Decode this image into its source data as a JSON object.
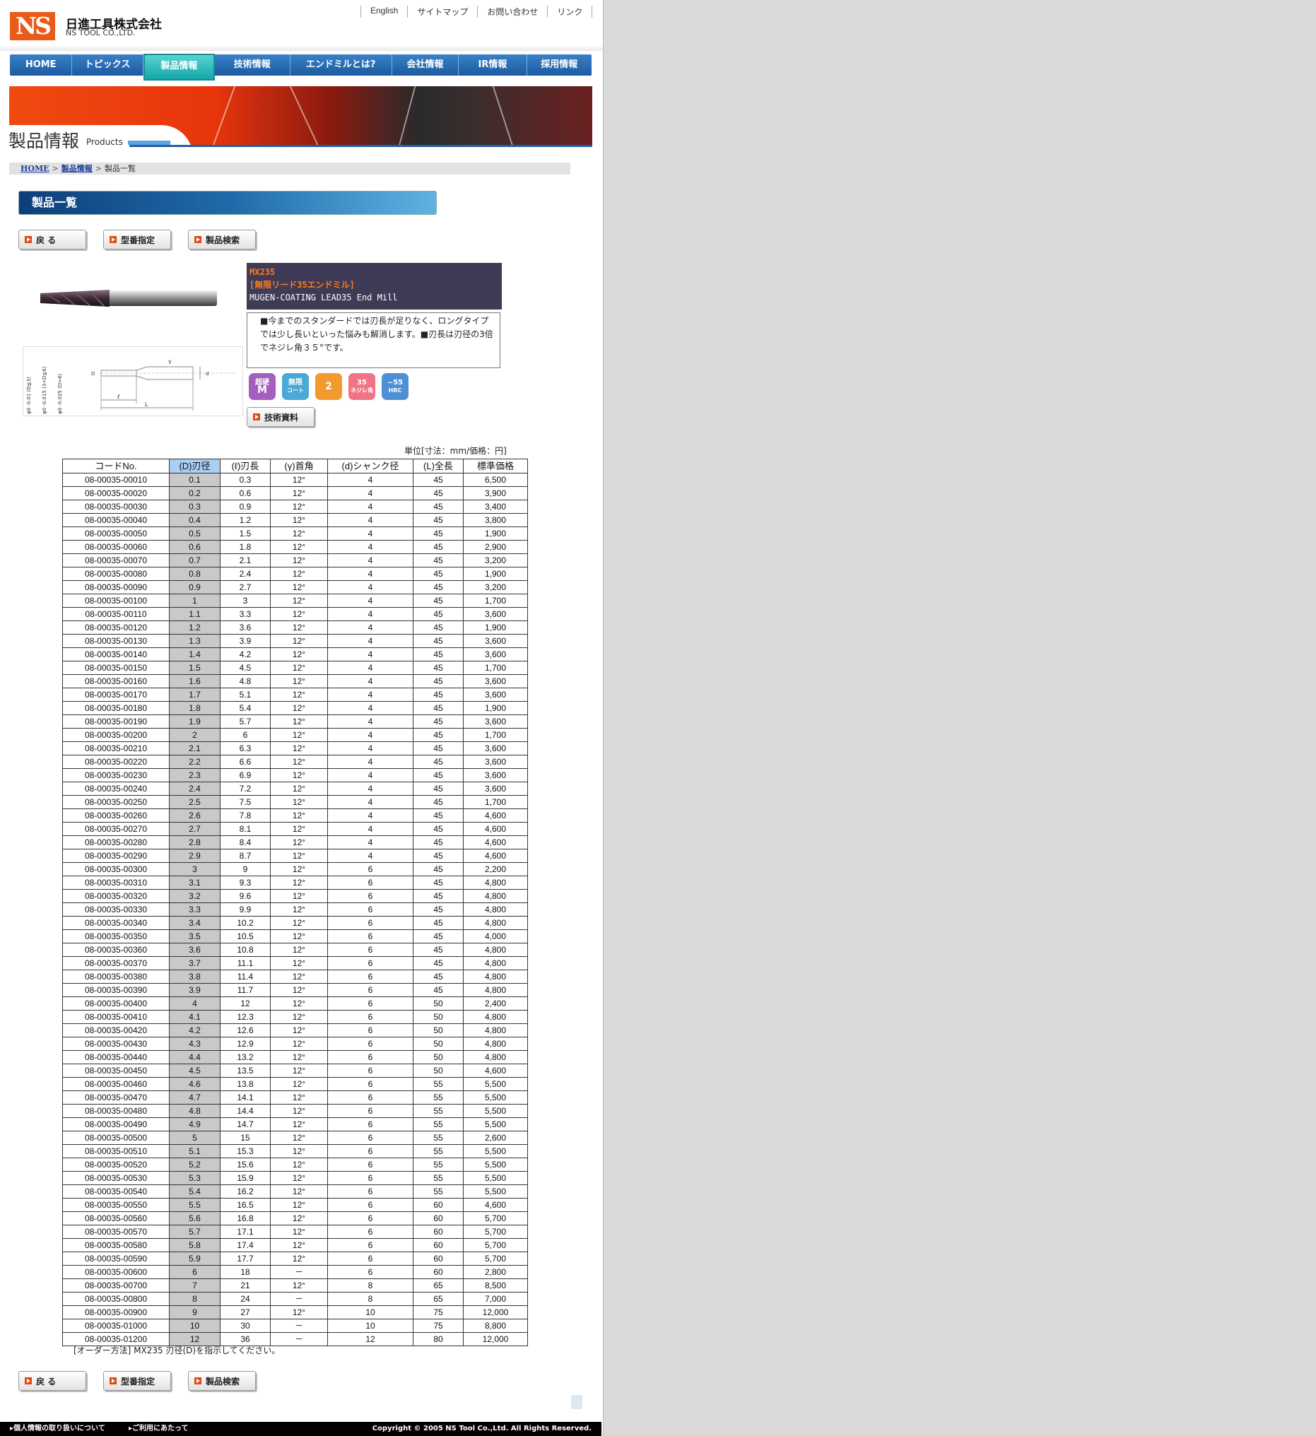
{
  "header": {
    "logo_text": "NS",
    "company_name": "日進工具株式会社",
    "company_name_en": "NS TOOL CO.,LTD.",
    "util_nav": [
      "English",
      "サイトマップ",
      "お問い合わせ",
      "リンク"
    ]
  },
  "main_nav": {
    "items": [
      "HOME",
      "トピックス",
      "製品情報",
      "技術情報",
      "エンドミルとは?",
      "会社情報",
      "IR情報",
      "採用情報"
    ],
    "active": "製品情報"
  },
  "banner": {
    "title": "製品情報",
    "subtitle": "Products"
  },
  "breadcrumb": {
    "home": "HOME",
    "products": "製品情報",
    "current": "製品一覧"
  },
  "section_title": "製品一覧",
  "buttons": {
    "back": "戻 る",
    "model_select": "型番指定",
    "product_search": "製品検索",
    "tech_docs": "技術資料"
  },
  "product": {
    "code": "MX235",
    "name_jp": "[無限リード35エンドミル]",
    "name_en": "MUGEN-COATING LEAD35 End Mill",
    "description": "■今までのスタンダードでは刃長が足りなく、ロングタイプでは少し長いといった悩みも解消します。■刃長は刃径の3倍でネジレ角３５°です。",
    "drawing_labels": {
      "shank_tol_small": "φ0 -0.01 (D≦3)",
      "shank_tol_mid": "φ0 -0.015 (3<D≦6)",
      "shank_tol_large": "φ0 -0.025 (D>6)",
      "gamma": "γ",
      "l": "ℓ",
      "L": "L",
      "d": "d",
      "D": "D"
    },
    "feature_icons": [
      {
        "name": "super-hard-m-icon",
        "line1": "超硬",
        "line2": "M",
        "color": "#a35fbe"
      },
      {
        "name": "mugen-coat-icon",
        "line1": "無限",
        "line2": "コート",
        "color": "#4aa9d8"
      },
      {
        "name": "two-flute-icon",
        "line1": "",
        "line2": "2",
        "color": "#f29a2e"
      },
      {
        "name": "helix-35-icon",
        "line1": "35",
        "line2": "ネジレ角",
        "color": "#f07484"
      },
      {
        "name": "hrc-55-icon",
        "line1": "~55",
        "line2": "HRC",
        "color": "#4f8fd6"
      }
    ]
  },
  "table": {
    "unit_note": "単位[寸法：mm/価格：円]",
    "headers": [
      "コードNo.",
      "(D)刃径",
      "(ℓ)刃長",
      "(γ)首角",
      "(d)シャンク径",
      "(L)全長",
      "標準価格"
    ],
    "highlight_header": "(D)刃径",
    "rows": [
      [
        "08-00035-00010",
        "0.1",
        "0.3",
        "12°",
        "4",
        "45",
        "6,500"
      ],
      [
        "08-00035-00020",
        "0.2",
        "0.6",
        "12°",
        "4",
        "45",
        "3,900"
      ],
      [
        "08-00035-00030",
        "0.3",
        "0.9",
        "12°",
        "4",
        "45",
        "3,400"
      ],
      [
        "08-00035-00040",
        "0.4",
        "1.2",
        "12°",
        "4",
        "45",
        "3,800"
      ],
      [
        "08-00035-00050",
        "0.5",
        "1.5",
        "12°",
        "4",
        "45",
        "1,900"
      ],
      [
        "08-00035-00060",
        "0.6",
        "1.8",
        "12°",
        "4",
        "45",
        "2,900"
      ],
      [
        "08-00035-00070",
        "0.7",
        "2.1",
        "12°",
        "4",
        "45",
        "3,200"
      ],
      [
        "08-00035-00080",
        "0.8",
        "2.4",
        "12°",
        "4",
        "45",
        "1,900"
      ],
      [
        "08-00035-00090",
        "0.9",
        "2.7",
        "12°",
        "4",
        "45",
        "3,200"
      ],
      [
        "08-00035-00100",
        "1",
        "3",
        "12°",
        "4",
        "45",
        "1,700"
      ],
      [
        "08-00035-00110",
        "1.1",
        "3.3",
        "12°",
        "4",
        "45",
        "3,600"
      ],
      [
        "08-00035-00120",
        "1.2",
        "3.6",
        "12°",
        "4",
        "45",
        "1,900"
      ],
      [
        "08-00035-00130",
        "1.3",
        "3.9",
        "12°",
        "4",
        "45",
        "3,600"
      ],
      [
        "08-00035-00140",
        "1.4",
        "4.2",
        "12°",
        "4",
        "45",
        "3,600"
      ],
      [
        "08-00035-00150",
        "1.5",
        "4.5",
        "12°",
        "4",
        "45",
        "1,700"
      ],
      [
        "08-00035-00160",
        "1.6",
        "4.8",
        "12°",
        "4",
        "45",
        "3,600"
      ],
      [
        "08-00035-00170",
        "1.7",
        "5.1",
        "12°",
        "4",
        "45",
        "3,600"
      ],
      [
        "08-00035-00180",
        "1.8",
        "5.4",
        "12°",
        "4",
        "45",
        "1,900"
      ],
      [
        "08-00035-00190",
        "1.9",
        "5.7",
        "12°",
        "4",
        "45",
        "3,600"
      ],
      [
        "08-00035-00200",
        "2",
        "6",
        "12°",
        "4",
        "45",
        "1,700"
      ],
      [
        "08-00035-00210",
        "2.1",
        "6.3",
        "12°",
        "4",
        "45",
        "3,600"
      ],
      [
        "08-00035-00220",
        "2.2",
        "6.6",
        "12°",
        "4",
        "45",
        "3,600"
      ],
      [
        "08-00035-00230",
        "2.3",
        "6.9",
        "12°",
        "4",
        "45",
        "3,600"
      ],
      [
        "08-00035-00240",
        "2.4",
        "7.2",
        "12°",
        "4",
        "45",
        "3,600"
      ],
      [
        "08-00035-00250",
        "2.5",
        "7.5",
        "12°",
        "4",
        "45",
        "1,700"
      ],
      [
        "08-00035-00260",
        "2.6",
        "7.8",
        "12°",
        "4",
        "45",
        "4,600"
      ],
      [
        "08-00035-00270",
        "2.7",
        "8.1",
        "12°",
        "4",
        "45",
        "4,600"
      ],
      [
        "08-00035-00280",
        "2.8",
        "8.4",
        "12°",
        "4",
        "45",
        "4,600"
      ],
      [
        "08-00035-00290",
        "2.9",
        "8.7",
        "12°",
        "4",
        "45",
        "4,600"
      ],
      [
        "08-00035-00300",
        "3",
        "9",
        "12°",
        "6",
        "45",
        "2,200"
      ],
      [
        "08-00035-00310",
        "3.1",
        "9.3",
        "12°",
        "6",
        "45",
        "4,800"
      ],
      [
        "08-00035-00320",
        "3.2",
        "9.6",
        "12°",
        "6",
        "45",
        "4,800"
      ],
      [
        "08-00035-00330",
        "3.3",
        "9.9",
        "12°",
        "6",
        "45",
        "4,800"
      ],
      [
        "08-00035-00340",
        "3.4",
        "10.2",
        "12°",
        "6",
        "45",
        "4,800"
      ],
      [
        "08-00035-00350",
        "3.5",
        "10.5",
        "12°",
        "6",
        "45",
        "4,000"
      ],
      [
        "08-00035-00360",
        "3.6",
        "10.8",
        "12°",
        "6",
        "45",
        "4,800"
      ],
      [
        "08-00035-00370",
        "3.7",
        "11.1",
        "12°",
        "6",
        "45",
        "4,800"
      ],
      [
        "08-00035-00380",
        "3.8",
        "11.4",
        "12°",
        "6",
        "45",
        "4,800"
      ],
      [
        "08-00035-00390",
        "3.9",
        "11.7",
        "12°",
        "6",
        "45",
        "4,800"
      ],
      [
        "08-00035-00400",
        "4",
        "12",
        "12°",
        "6",
        "50",
        "2,400"
      ],
      [
        "08-00035-00410",
        "4.1",
        "12.3",
        "12°",
        "6",
        "50",
        "4,800"
      ],
      [
        "08-00035-00420",
        "4.2",
        "12.6",
        "12°",
        "6",
        "50",
        "4,800"
      ],
      [
        "08-00035-00430",
        "4.3",
        "12.9",
        "12°",
        "6",
        "50",
        "4,800"
      ],
      [
        "08-00035-00440",
        "4.4",
        "13.2",
        "12°",
        "6",
        "50",
        "4,800"
      ],
      [
        "08-00035-00450",
        "4.5",
        "13.5",
        "12°",
        "6",
        "50",
        "4,600"
      ],
      [
        "08-00035-00460",
        "4.6",
        "13.8",
        "12°",
        "6",
        "55",
        "5,500"
      ],
      [
        "08-00035-00470",
        "4.7",
        "14.1",
        "12°",
        "6",
        "55",
        "5,500"
      ],
      [
        "08-00035-00480",
        "4.8",
        "14.4",
        "12°",
        "6",
        "55",
        "5,500"
      ],
      [
        "08-00035-00490",
        "4.9",
        "14.7",
        "12°",
        "6",
        "55",
        "5,500"
      ],
      [
        "08-00035-00500",
        "5",
        "15",
        "12°",
        "6",
        "55",
        "2,600"
      ],
      [
        "08-00035-00510",
        "5.1",
        "15.3",
        "12°",
        "6",
        "55",
        "5,500"
      ],
      [
        "08-00035-00520",
        "5.2",
        "15.6",
        "12°",
        "6",
        "55",
        "5,500"
      ],
      [
        "08-00035-00530",
        "5.3",
        "15.9",
        "12°",
        "6",
        "55",
        "5,500"
      ],
      [
        "08-00035-00540",
        "5.4",
        "16.2",
        "12°",
        "6",
        "55",
        "5,500"
      ],
      [
        "08-00035-00550",
        "5.5",
        "16.5",
        "12°",
        "6",
        "60",
        "4,600"
      ],
      [
        "08-00035-00560",
        "5.6",
        "16.8",
        "12°",
        "6",
        "60",
        "5,700"
      ],
      [
        "08-00035-00570",
        "5.7",
        "17.1",
        "12°",
        "6",
        "60",
        "5,700"
      ],
      [
        "08-00035-00580",
        "5.8",
        "17.4",
        "12°",
        "6",
        "60",
        "5,700"
      ],
      [
        "08-00035-00590",
        "5.9",
        "17.7",
        "12°",
        "6",
        "60",
        "5,700"
      ],
      [
        "08-00035-00600",
        "6",
        "18",
        "－",
        "6",
        "60",
        "2,800"
      ],
      [
        "08-00035-00700",
        "7",
        "21",
        "12°",
        "8",
        "65",
        "8,500"
      ],
      [
        "08-00035-00800",
        "8",
        "24",
        "－",
        "8",
        "65",
        "7,000"
      ],
      [
        "08-00035-00900",
        "9",
        "27",
        "12°",
        "10",
        "75",
        "12,000"
      ],
      [
        "08-00035-01000",
        "10",
        "30",
        "－",
        "10",
        "75",
        "8,800"
      ],
      [
        "08-00035-01200",
        "12",
        "36",
        "－",
        "12",
        "80",
        "12,000"
      ]
    ],
    "order_note": "[オーダー方法] MX235 刃径(D)を指示してください。"
  },
  "footer": {
    "privacy": "▸個人情報の取り扱いについて",
    "terms": "▸ご利用にあたって",
    "copyright": "Copyright © 2005 NS Tool Co.,Ltd. All Rights Reserved."
  }
}
